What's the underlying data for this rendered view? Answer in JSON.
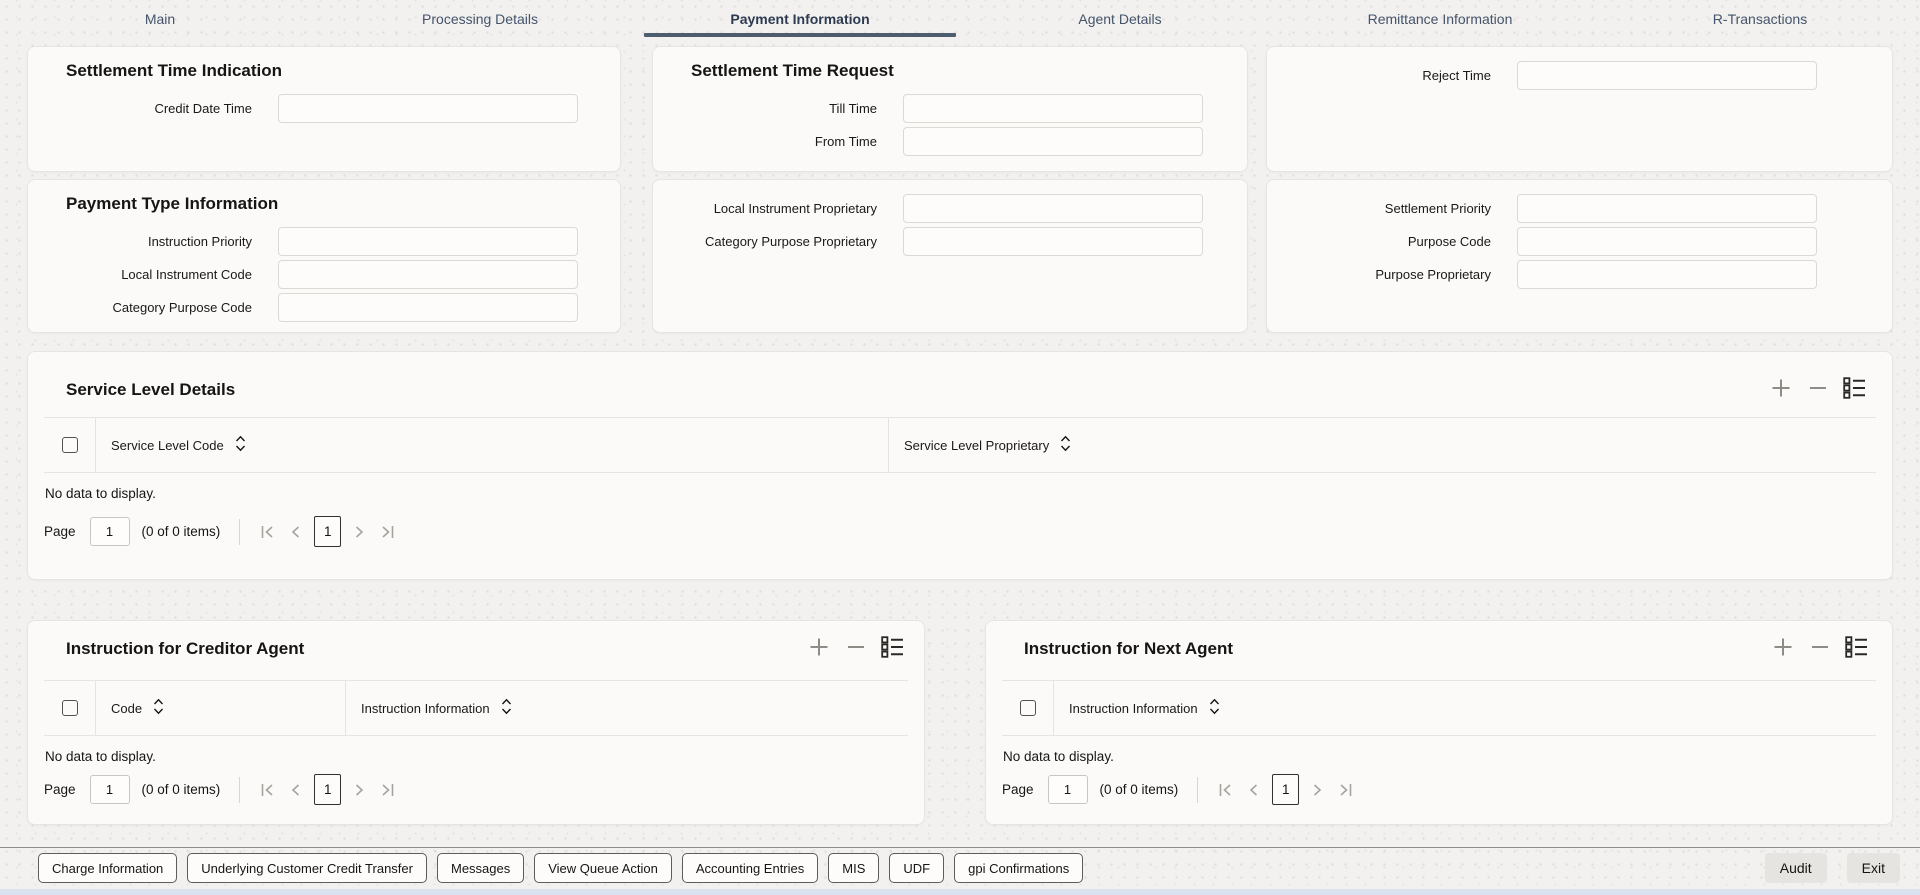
{
  "tabs": {
    "items": [
      "Main",
      "Processing Details",
      "Payment Information",
      "Agent Details",
      "Remittance Information",
      "R-Transactions"
    ],
    "active": "Payment Information"
  },
  "sections": {
    "settlement_time_indication": {
      "title": "Settlement Time Indication",
      "credit_date_time": {
        "label": "Credit Date Time",
        "value": "",
        "placeholder": ""
      }
    },
    "settlement_time_request": {
      "title": "Settlement Time Request",
      "till_time": {
        "label": "Till Time",
        "value": "",
        "placeholder": ""
      },
      "from_time": {
        "label": "From Time",
        "value": "",
        "placeholder": ""
      }
    },
    "reject_time_panel": {
      "reject_time": {
        "label": "Reject Time",
        "value": "",
        "placeholder": ""
      }
    },
    "payment_type_information": {
      "title": "Payment Type Information",
      "instruction_priority": {
        "label": "Instruction Priority",
        "value": "",
        "placeholder": ""
      },
      "local_instrument_code": {
        "label": "Local Instrument Code",
        "value": "",
        "placeholder": ""
      },
      "category_purpose_code": {
        "label": "Category Purpose Code",
        "value": "",
        "placeholder": ""
      }
    },
    "proprietary_panel": {
      "local_instrument_proprietary": {
        "label": "Local Instrument Proprietary",
        "value": "",
        "placeholder": ""
      },
      "category_purpose_proprietary": {
        "label": "Category Purpose Proprietary",
        "value": "",
        "placeholder": ""
      }
    },
    "priority_purpose_panel": {
      "settlement_priority": {
        "label": "Settlement Priority",
        "value": "",
        "placeholder": ""
      },
      "purpose_code": {
        "label": "Purpose Code",
        "value": "",
        "placeholder": ""
      },
      "purpose_proprietary": {
        "label": "Purpose Proprietary",
        "value": "",
        "placeholder": ""
      }
    }
  },
  "service_level_details": {
    "title": "Service Level Details",
    "columns": {
      "service_level_code": "Service Level Code",
      "service_level_proprietary": "Service Level Proprietary"
    },
    "rows": [],
    "empty_text": "No data to display."
  },
  "instruction_for_creditor_agent": {
    "title": "Instruction for Creditor Agent",
    "columns": {
      "code": "Code",
      "instruction_information": "Instruction Information"
    },
    "rows": [],
    "empty_text": "No data to display."
  },
  "instruction_for_next_agent": {
    "title": "Instruction for Next Agent",
    "columns": {
      "instruction_information": "Instruction Information"
    },
    "rows": [],
    "empty_text": "No data to display."
  },
  "pagination": {
    "page_label": "Page",
    "page_input_value": "1",
    "items_text": "(0 of 0 items)",
    "current_page": "1"
  },
  "footer": {
    "actions": [
      "Charge Information",
      "Underlying Customer Credit Transfer",
      "Messages",
      "View Queue Action",
      "Accounting Entries",
      "MIS",
      "UDF",
      "gpi Confirmations"
    ],
    "audit_label": "Audit",
    "exit_label": "Exit"
  },
  "icons": {
    "add": "plus cross",
    "remove": "minus dash",
    "detail_view": "list with squares",
    "sort": "up-down chevrons",
    "first_page": "bar + left chevron",
    "previous_page": "left chevron",
    "next_page": "right chevron",
    "last_page": "right chevron + bar",
    "select_checkbox": "empty square"
  },
  "colors": {
    "active_tab_underline": "#4e5c70",
    "panel_background": "#fbfaf8",
    "page_background": "#f3f1ef",
    "bottom_strip": "#d9e2ee",
    "disabled_icon": "#a6a29d"
  }
}
